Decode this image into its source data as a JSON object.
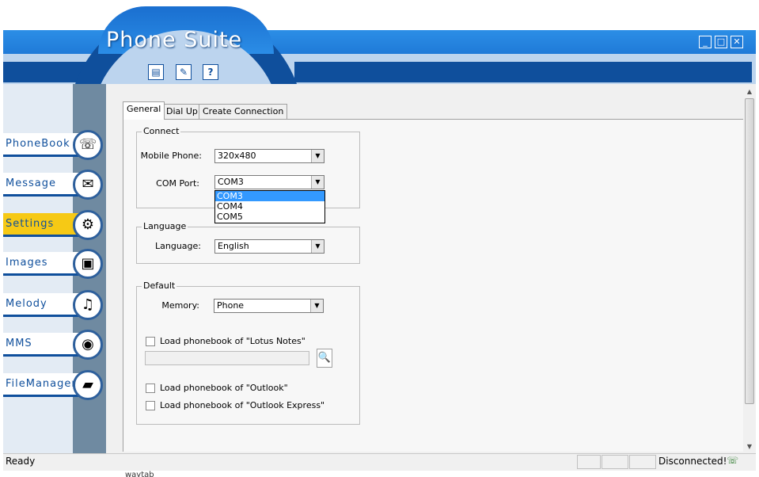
{
  "app": {
    "title": "Phone Suite"
  },
  "window_controls": {
    "minimize": "_",
    "maximize": "□",
    "close": "✕"
  },
  "toolbar": [
    {
      "icon": "notes-icon",
      "glyph": "▤"
    },
    {
      "icon": "edit-icon",
      "glyph": "✎"
    },
    {
      "icon": "help-icon",
      "glyph": "?"
    }
  ],
  "sidebar": {
    "items": [
      {
        "label": "PhoneBook",
        "icon": "phone-icon",
        "glyph": "☏",
        "active": false
      },
      {
        "label": "Message",
        "icon": "envelope-icon",
        "glyph": "✉",
        "active": false
      },
      {
        "label": "Settings",
        "icon": "tools-icon",
        "glyph": "⚙",
        "active": true
      },
      {
        "label": "Images",
        "icon": "images-icon",
        "glyph": "▣",
        "active": false
      },
      {
        "label": "Melody",
        "icon": "music-icon",
        "glyph": "♫",
        "active": false
      },
      {
        "label": "MMS",
        "icon": "balloon-icon",
        "glyph": "◉",
        "active": false
      },
      {
        "label": "FileManager",
        "icon": "folder-icon",
        "glyph": "▰",
        "active": false
      }
    ]
  },
  "tabs": [
    {
      "label": "General",
      "active": true
    },
    {
      "label": "Dial Up",
      "active": false
    },
    {
      "label": "Create Connection",
      "active": false
    }
  ],
  "connect": {
    "group_title": "Connect",
    "mobile_phone_label": "Mobile Phone:",
    "mobile_phone_value": "320x480",
    "com_port_label": "COM Port:",
    "com_port_value": "COM3",
    "com_port_options": [
      "COM3",
      "COM4",
      "COM5"
    ]
  },
  "language": {
    "group_title": "Language",
    "label": "Language:",
    "value": "English"
  },
  "default": {
    "group_title": "Default",
    "memory_label": "Memory:",
    "memory_value": "Phone",
    "lotus_label": "Load phonebook of \"Lotus Notes\"",
    "lotus_path": "",
    "outlook_label": "Load phonebook of \"Outlook\"",
    "outlook_express_label": "Load phonebook of \"Outlook Express\""
  },
  "status": {
    "left": "Ready",
    "right": "Disconnected!"
  },
  "below_window": {
    "text": "waytab"
  }
}
